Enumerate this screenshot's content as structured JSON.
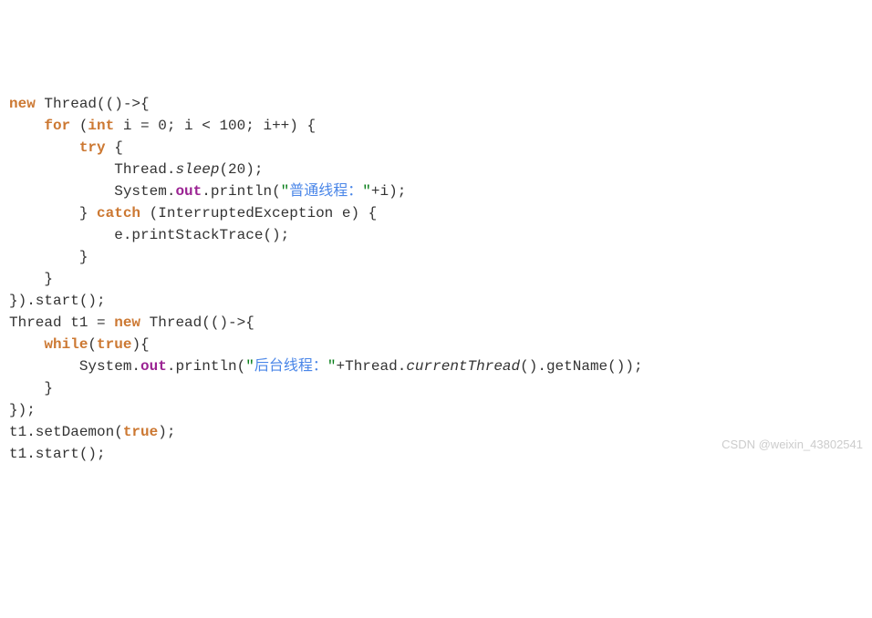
{
  "code": {
    "l1_new": "new",
    "l1_thread": " Thread(()->{",
    "l2_indent": "    ",
    "l2_for": "for",
    "l2_paren": " (",
    "l2_int": "int",
    "l2_rest": " i = 0; i < 100; i++) {",
    "l3_indent": "        ",
    "l3_try": "try",
    "l3_brace": " {",
    "l4_indent": "            Thread.",
    "l4_sleep": "sleep",
    "l4_rest": "(20);",
    "l5_indent": "            System.",
    "l5_out": "out",
    "l5_println": ".println(",
    "l5_q1": "\"",
    "l5_str": "普通线程：",
    "l5_q2": "\"",
    "l5_plus": "+i);",
    "l6_indent": "        } ",
    "l6_catch": "catch",
    "l6_rest": " (InterruptedException e) {",
    "l7_indent": "            e.printStackTrace();",
    "l8_indent": "        }",
    "l9_indent": "    }",
    "l10": "}).start();",
    "blank": "",
    "l12_a": "Thread t1 = ",
    "l12_new": "new",
    "l12_b": " Thread(()->{",
    "l13_indent": "    ",
    "l13_while": "while",
    "l13_paren": "(",
    "l13_true": "true",
    "l13_brace": "){",
    "l14_indent": "        System.",
    "l14_out": "out",
    "l14_println": ".println(",
    "l14_q1": "\"",
    "l14_str": "后台线程：",
    "l14_q2": "\"",
    "l14_plus": "+Thread.",
    "l14_ct": "currentThread",
    "l14_rest": "().getName());",
    "l15_indent": "    }",
    "l16": "});",
    "l17_a": "t1.setDaemon(",
    "l17_true": "true",
    "l17_b": ");",
    "l18": "t1.start();"
  },
  "watermark": "CSDN @weixin_43802541"
}
